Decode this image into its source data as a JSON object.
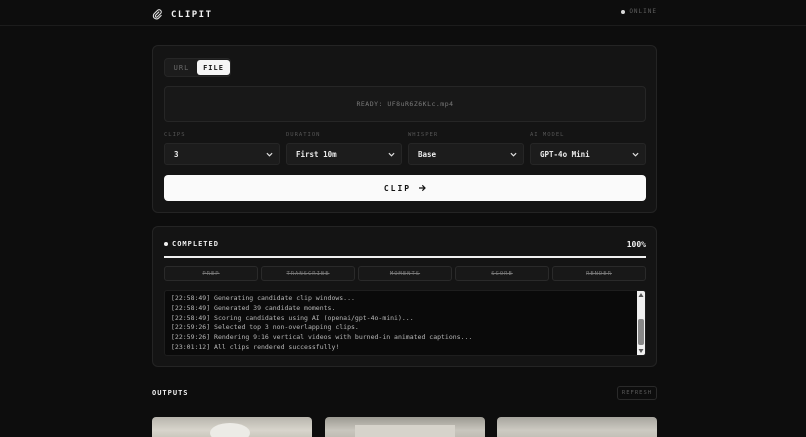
{
  "app": {
    "name": "CLIPIT",
    "status": "ONLINE"
  },
  "source": {
    "tabs": [
      {
        "label": "URL",
        "active": false
      },
      {
        "label": "FILE",
        "active": true
      }
    ],
    "dropzone_text": "READY: UF8uR6Z6KLc.mp4"
  },
  "options": [
    {
      "label": "CLIPS",
      "value": "3"
    },
    {
      "label": "DURATION",
      "value": "First 10m"
    },
    {
      "label": "WHISPER",
      "value": "Base"
    },
    {
      "label": "AI MODEL",
      "value": "GPT-4o Mini"
    }
  ],
  "clip_button_label": "CLIP",
  "progress": {
    "status": "COMPLETED",
    "percent_label": "100%",
    "percent": 100,
    "stages": [
      "PREP",
      "TRANSCRIBE",
      "MOMENTS",
      "SCORE",
      "RENDER"
    ],
    "log": [
      "[22:58:49] Generating candidate clip windows...",
      "[22:58:49] Generated 39 candidate moments.",
      "[22:58:49] Scoring candidates using AI (openai/gpt-4o-mini)...",
      "[22:59:26] Selected top 3 non-overlapping clips.",
      "[22:59:26] Rendering 9:16 vertical videos with burned-in animated captions...",
      "[23:01:12] All clips rendered successfully!"
    ]
  },
  "outputs": {
    "title": "OUTPUTS",
    "refresh_label": "REFRESH"
  },
  "colors": {
    "background": "#0d0d0d",
    "card": "#141414",
    "accent": "#fafafa",
    "muted": "#5e5e5e"
  }
}
